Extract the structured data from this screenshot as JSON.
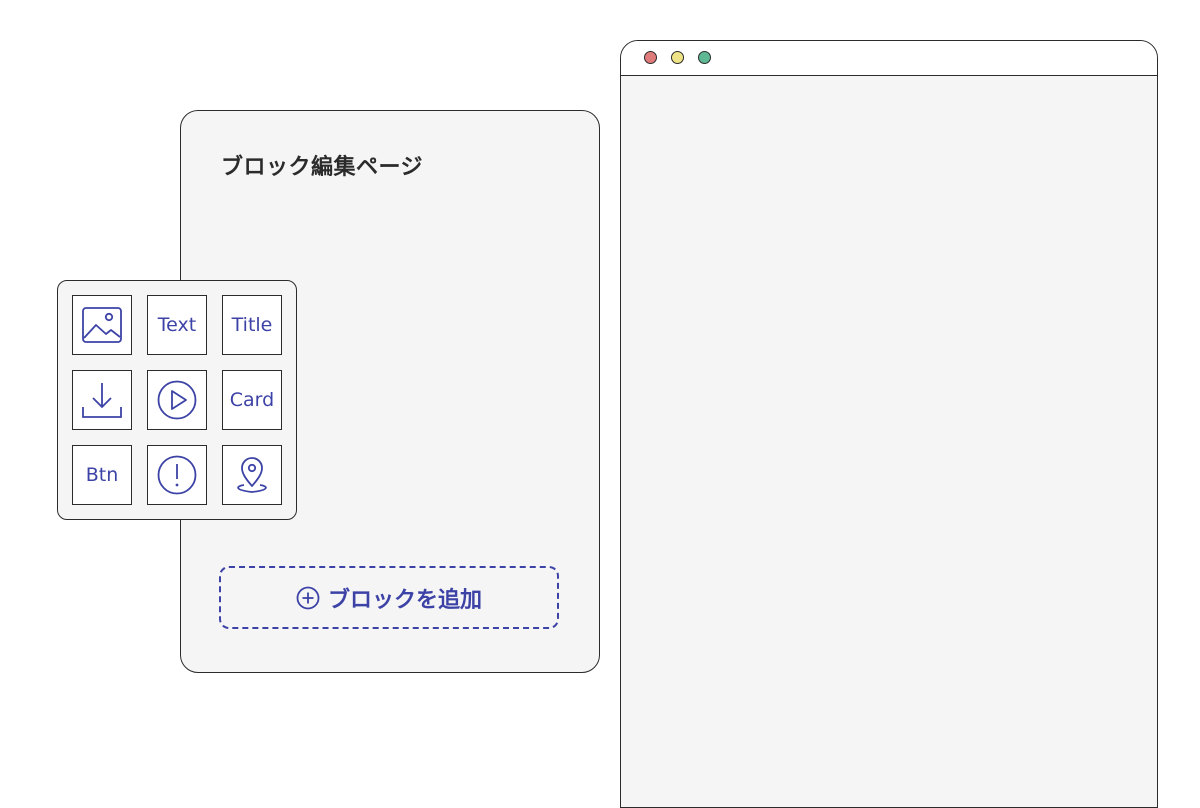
{
  "colors": {
    "accent": "#3d43a6",
    "stroke": "#2b2b2b",
    "panel_bg": "#f5f5f5",
    "traffic_red": "#e07b7b",
    "traffic_yellow": "#eee487",
    "traffic_green": "#5fb894"
  },
  "editor": {
    "title": "ブロック編集ページ",
    "add_block_label": "ブロックを追加"
  },
  "palette": {
    "text_label": "Text",
    "title_label": "Title",
    "card_label": "Card",
    "button_label": "Btn",
    "icons": [
      "image-icon",
      "download-icon",
      "play-icon",
      "alert-icon",
      "map-pin-icon"
    ]
  }
}
